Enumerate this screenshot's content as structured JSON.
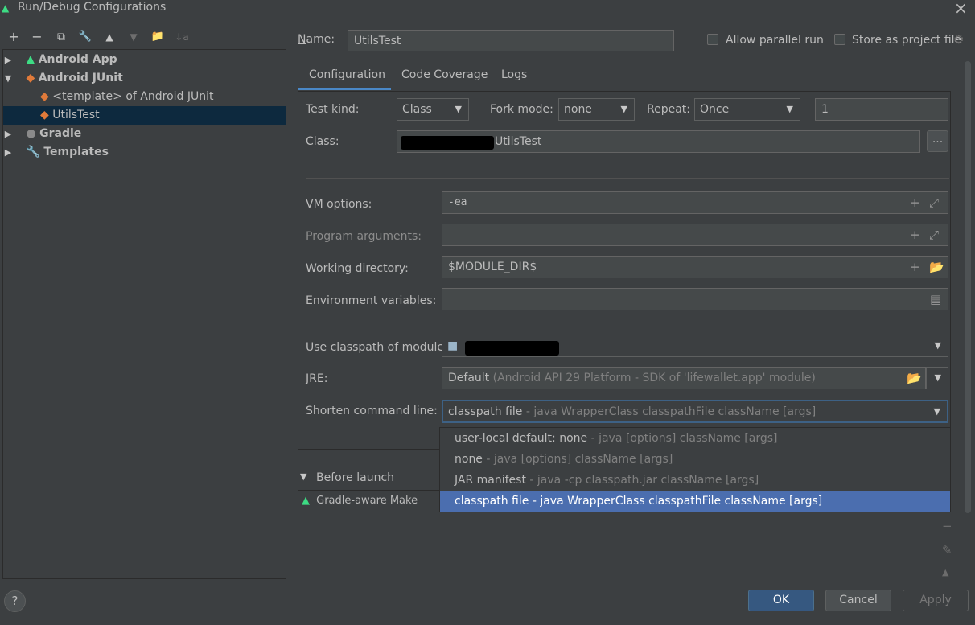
{
  "window": {
    "title": "Run/Debug Configurations"
  },
  "toolbar": {
    "add": "+",
    "remove": "−",
    "copy": "⧉",
    "edit": "🔧",
    "up": "▲",
    "down": "▼",
    "folder": "📁",
    "sort": "↓a"
  },
  "tree": {
    "android_app": "Android App",
    "android_junit": "Android JUnit",
    "template": "<template> of Android JUnit",
    "utils_test": "UtilsTest",
    "gradle": "Gradle",
    "templates": "Templates"
  },
  "header": {
    "name_label": "Name:",
    "name_value": "UtilsTest",
    "allow_parallel": "Allow parallel run",
    "store_as_project": "Store as project file"
  },
  "tabs": [
    "Configuration",
    "Code Coverage",
    "Logs"
  ],
  "config": {
    "test_kind_label": "Test kind:",
    "test_kind_value": "Class",
    "fork_mode_label": "Fork mode:",
    "fork_mode_value": "none",
    "repeat_label": "Repeat:",
    "repeat_value": "Once",
    "repeat_count": "1",
    "class_label": "Class:",
    "class_value": "UtilsTest",
    "browse": "...",
    "vm_options_label": "VM options:",
    "vm_options_value": "-ea",
    "program_args_label": "Program arguments:",
    "working_dir_label": "Working directory:",
    "working_dir_value": "$MODULE_DIR$",
    "env_vars_label": "Environment variables:",
    "classpath_label": "Use classpath of module:",
    "jre_label": "JRE:",
    "jre_value": "Default",
    "jre_hint": "(Android API 29 Platform - SDK of 'lifewallet.app' module)",
    "shorten_label": "Shorten command line:",
    "shorten_value": "classpath file",
    "shorten_hint": "- java WrapperClass classpathFile className [args]"
  },
  "dropdown": [
    {
      "main": "user-local default: none",
      "hint": "- java [options] className [args]"
    },
    {
      "main": "none",
      "hint": "- java [options] className [args]"
    },
    {
      "main": "JAR manifest",
      "hint": "- java -cp classpath.jar className [args]"
    },
    {
      "main": "classpath file",
      "hint": "- java WrapperClass classpathFile className [args]"
    }
  ],
  "before_launch": {
    "label": "Before launch",
    "item": "Gradle-aware Make"
  },
  "footer": {
    "help": "?",
    "ok": "OK",
    "cancel": "Cancel",
    "apply": "Apply"
  },
  "colors": {
    "accent": "#4b6eaf",
    "android_green": "#3ddc84",
    "junit_orange": "#e07a3a"
  }
}
